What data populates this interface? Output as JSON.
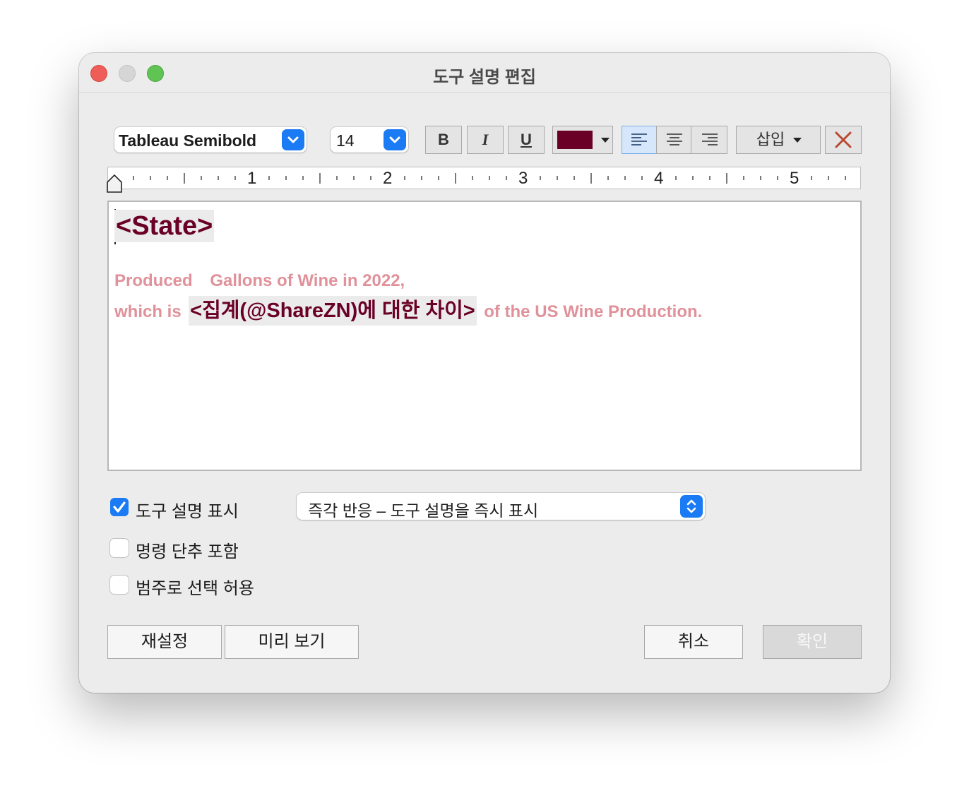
{
  "window": {
    "title": "도구 설명 편집"
  },
  "toolbar": {
    "font_family": "Tableau Semibold",
    "font_size": "14",
    "bold_label": "B",
    "italic_label": "I",
    "underline_label": "U",
    "text_color": "#6b0026",
    "align_selected": "left",
    "insert_label": "삽입",
    "clear_icon": "x-icon"
  },
  "ruler": {
    "labels": [
      "1",
      "2",
      "3",
      "4",
      "5"
    ]
  },
  "editor": {
    "field_state": "<State>",
    "line1_part1": "Produced",
    "line1_part2": "Gallons of Wine in 2022,",
    "line2_part1": "which is",
    "field_share": "<집계(@ShareZN)에 대한 차이>",
    "line2_part3": "of the US Wine Production.",
    "colors": {
      "field": "#6a0026",
      "text": "#e0919a"
    }
  },
  "options": {
    "show_tooltip": {
      "label": "도구 설명 표시",
      "checked": true
    },
    "tooltip_mode": "즉각 반응 – 도구 설명을 즉시 표시",
    "include_commands": {
      "label": "명령 단추 포함",
      "checked": false
    },
    "allow_category_select": {
      "label": "범주로 선택 허용",
      "checked": false
    }
  },
  "buttons": {
    "reset": "재설정",
    "preview": "미리 보기",
    "cancel": "취소",
    "ok": "확인"
  }
}
